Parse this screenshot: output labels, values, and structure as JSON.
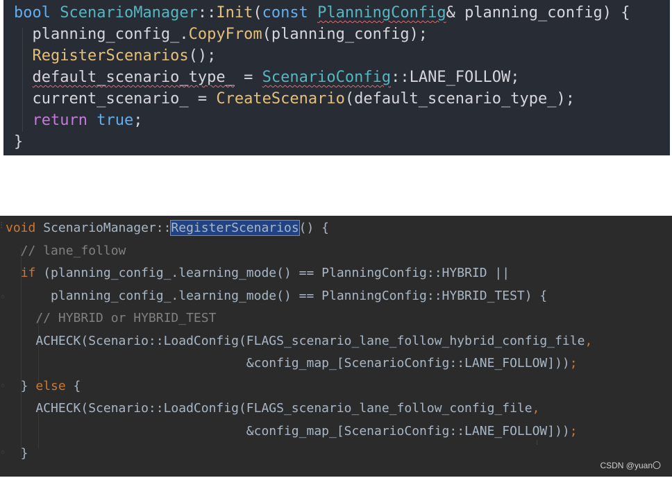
{
  "panel1": {
    "lines": [
      {
        "tokens": [
          {
            "t": "bool ",
            "c": "kw1"
          },
          {
            "t": "ScenarioManager",
            "c": "typ1"
          },
          {
            "t": "::",
            "c": "id1"
          },
          {
            "t": "Init",
            "c": "fn1"
          },
          {
            "t": "(",
            "c": "id1"
          },
          {
            "t": "const ",
            "c": "kw1"
          },
          {
            "t": "PlanningConfig",
            "c": "typ1 wavy"
          },
          {
            "t": "& planning_config) {",
            "c": "id1"
          }
        ]
      },
      {
        "tokens": [
          {
            "t": "  planning_config_.",
            "c": "id1"
          },
          {
            "t": "CopyFrom",
            "c": "fn1"
          },
          {
            "t": "(planning_config);",
            "c": "id1"
          }
        ]
      },
      {
        "tokens": [
          {
            "t": "  ",
            "c": "id1"
          },
          {
            "t": "RegisterScenarios",
            "c": "fn1"
          },
          {
            "t": "();",
            "c": "id1"
          }
        ]
      },
      {
        "tokens": [
          {
            "t": "  ",
            "c": "id1"
          },
          {
            "t": "default_scenario_type_",
            "c": "id1 wavy"
          },
          {
            "t": " = ",
            "c": "id1"
          },
          {
            "t": "ScenarioConfig",
            "c": "typ1 wavy"
          },
          {
            "t": "::LANE_FOLLOW;",
            "c": "id1"
          }
        ]
      },
      {
        "tokens": [
          {
            "t": "  current_scenario_ = ",
            "c": "id1"
          },
          {
            "t": "CreateScenario",
            "c": "fn1"
          },
          {
            "t": "(default_scenario_type_);",
            "c": "id1"
          }
        ]
      },
      {
        "tokens": [
          {
            "t": "  ",
            "c": "id1"
          },
          {
            "t": "return ",
            "c": "kwp"
          },
          {
            "t": "true",
            "c": "kw1"
          },
          {
            "t": ";",
            "c": "id1"
          }
        ]
      },
      {
        "tokens": [
          {
            "t": "}",
            "c": "id1"
          }
        ]
      }
    ]
  },
  "panel2": {
    "lines": [
      {
        "tokens": [
          {
            "t": "void ",
            "c": "kw2"
          },
          {
            "t": "ScenarioManager::",
            "c": "id2"
          },
          {
            "t": "RegisterScenarios",
            "c": "id2 hl"
          },
          {
            "t": "() {",
            "c": "id2"
          }
        ]
      },
      {
        "tokens": [
          {
            "t": "  // lane_follow",
            "c": "cm2"
          }
        ]
      },
      {
        "tokens": [
          {
            "t": "  ",
            "c": "id2"
          },
          {
            "t": "if ",
            "c": "kw2"
          },
          {
            "t": "(planning_config_.learning_mode() == PlanningConfig::HYBRID ||",
            "c": "id2"
          }
        ]
      },
      {
        "tokens": [
          {
            "t": "      planning_config_.learning_mode() == PlanningConfig::HYBRID_TEST) {",
            "c": "id2"
          }
        ]
      },
      {
        "tokens": [
          {
            "t": "    // HYBRID or HYBRID_TEST",
            "c": "cm2"
          }
        ]
      },
      {
        "tokens": [
          {
            "t": "    ACHECK(Scenario::LoadConfig(FLAGS_scenario_lane_follow_hybrid_config_file",
            "c": "id2"
          },
          {
            "t": ",",
            "c": "kw2"
          }
        ]
      },
      {
        "tokens": [
          {
            "t": "                                &config_map_[ScenarioConfig::LANE_FOLLOW]))",
            "c": "id2"
          },
          {
            "t": ";",
            "c": "kw2"
          }
        ]
      },
      {
        "tokens": [
          {
            "t": "  } ",
            "c": "id2"
          },
          {
            "t": "else ",
            "c": "kw2"
          },
          {
            "t": "{",
            "c": "id2"
          }
        ]
      },
      {
        "tokens": [
          {
            "t": "    ACHECK(Scenario::LoadConfig(FLAGS_scenario_lane_follow_config_file",
            "c": "id2"
          },
          {
            "t": ",",
            "c": "kw2"
          }
        ]
      },
      {
        "tokens": [
          {
            "t": "                                &config_map_[ScenarioConfig::LANE_FOLLOW]))",
            "c": "id2"
          },
          {
            "t": ";",
            "c": "kw2"
          }
        ]
      },
      {
        "tokens": [
          {
            "t": "  }",
            "c": "id2"
          }
        ]
      }
    ]
  },
  "watermark": "CSDN @yuan〇"
}
